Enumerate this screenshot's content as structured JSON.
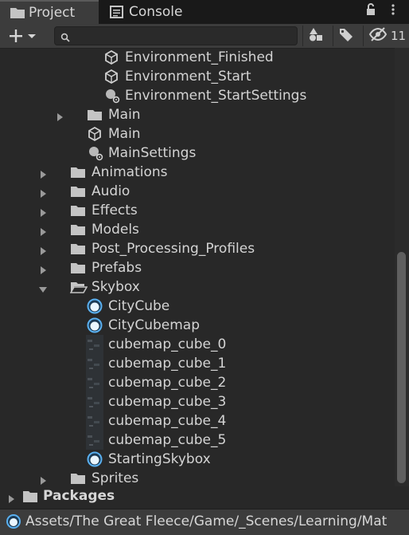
{
  "tabs": [
    {
      "label": "Project",
      "icon": "folder-icon",
      "active": true
    },
    {
      "label": "Console",
      "icon": "console-icon",
      "active": false
    }
  ],
  "toolbar": {
    "search_placeholder": "",
    "hidden_count": "11"
  },
  "tree": [
    {
      "label": "Environment_Finished",
      "icon": "unity-scene-icon",
      "depth": 3,
      "arrow": "none"
    },
    {
      "label": "Environment_Start",
      "icon": "unity-scene-icon",
      "depth": 3,
      "arrow": "none"
    },
    {
      "label": "Environment_StartSettings",
      "icon": "lighting-settings-icon",
      "depth": 3,
      "arrow": "none"
    },
    {
      "label": "Main",
      "icon": "folder-icon",
      "depth": 2,
      "arrow": "collapsed"
    },
    {
      "label": "Main",
      "icon": "unity-scene-icon",
      "depth": 2,
      "arrow": "none"
    },
    {
      "label": "MainSettings",
      "icon": "lighting-settings-icon",
      "depth": 2,
      "arrow": "none"
    },
    {
      "label": "Animations",
      "icon": "folder-icon",
      "depth": 1,
      "arrow": "collapsed"
    },
    {
      "label": "Audio",
      "icon": "folder-icon",
      "depth": 1,
      "arrow": "collapsed"
    },
    {
      "label": "Effects",
      "icon": "folder-icon",
      "depth": 1,
      "arrow": "collapsed"
    },
    {
      "label": "Models",
      "icon": "folder-icon",
      "depth": 1,
      "arrow": "collapsed"
    },
    {
      "label": "Post_Processing_Profiles",
      "icon": "folder-icon",
      "depth": 1,
      "arrow": "collapsed"
    },
    {
      "label": "Prefabs",
      "icon": "folder-icon",
      "depth": 1,
      "arrow": "collapsed"
    },
    {
      "label": "Skybox",
      "icon": "folder-open-icon",
      "depth": 1,
      "arrow": "expanded"
    },
    {
      "label": "CityCube",
      "icon": "material-icon",
      "depth": 2,
      "arrow": "none"
    },
    {
      "label": "CityCubemap",
      "icon": "material-icon",
      "depth": 2,
      "arrow": "none"
    },
    {
      "label": "cubemap_cube_0",
      "icon": "texture-icon",
      "depth": 2,
      "arrow": "none"
    },
    {
      "label": "cubemap_cube_1",
      "icon": "texture-icon",
      "depth": 2,
      "arrow": "none"
    },
    {
      "label": "cubemap_cube_2",
      "icon": "texture-icon",
      "depth": 2,
      "arrow": "none"
    },
    {
      "label": "cubemap_cube_3",
      "icon": "texture-icon",
      "depth": 2,
      "arrow": "none"
    },
    {
      "label": "cubemap_cube_4",
      "icon": "texture-icon",
      "depth": 2,
      "arrow": "none"
    },
    {
      "label": "cubemap_cube_5",
      "icon": "texture-icon",
      "depth": 2,
      "arrow": "none"
    },
    {
      "label": "StartingSkybox",
      "icon": "material-icon",
      "depth": 2,
      "arrow": "none"
    },
    {
      "label": "Sprites",
      "icon": "folder-icon",
      "depth": 1,
      "arrow": "collapsed"
    }
  ],
  "packages": {
    "label": "Packages",
    "icon": "folder-icon"
  },
  "status_bar": {
    "path": "Assets/The Great Fleece/Game/_Scenes/Learning/Mat",
    "icon": "material-icon"
  },
  "colors": {
    "background": "#282828",
    "toolbar": "#3c3c3c",
    "text": "#d4d4d4",
    "material": "#5ab0f0"
  }
}
